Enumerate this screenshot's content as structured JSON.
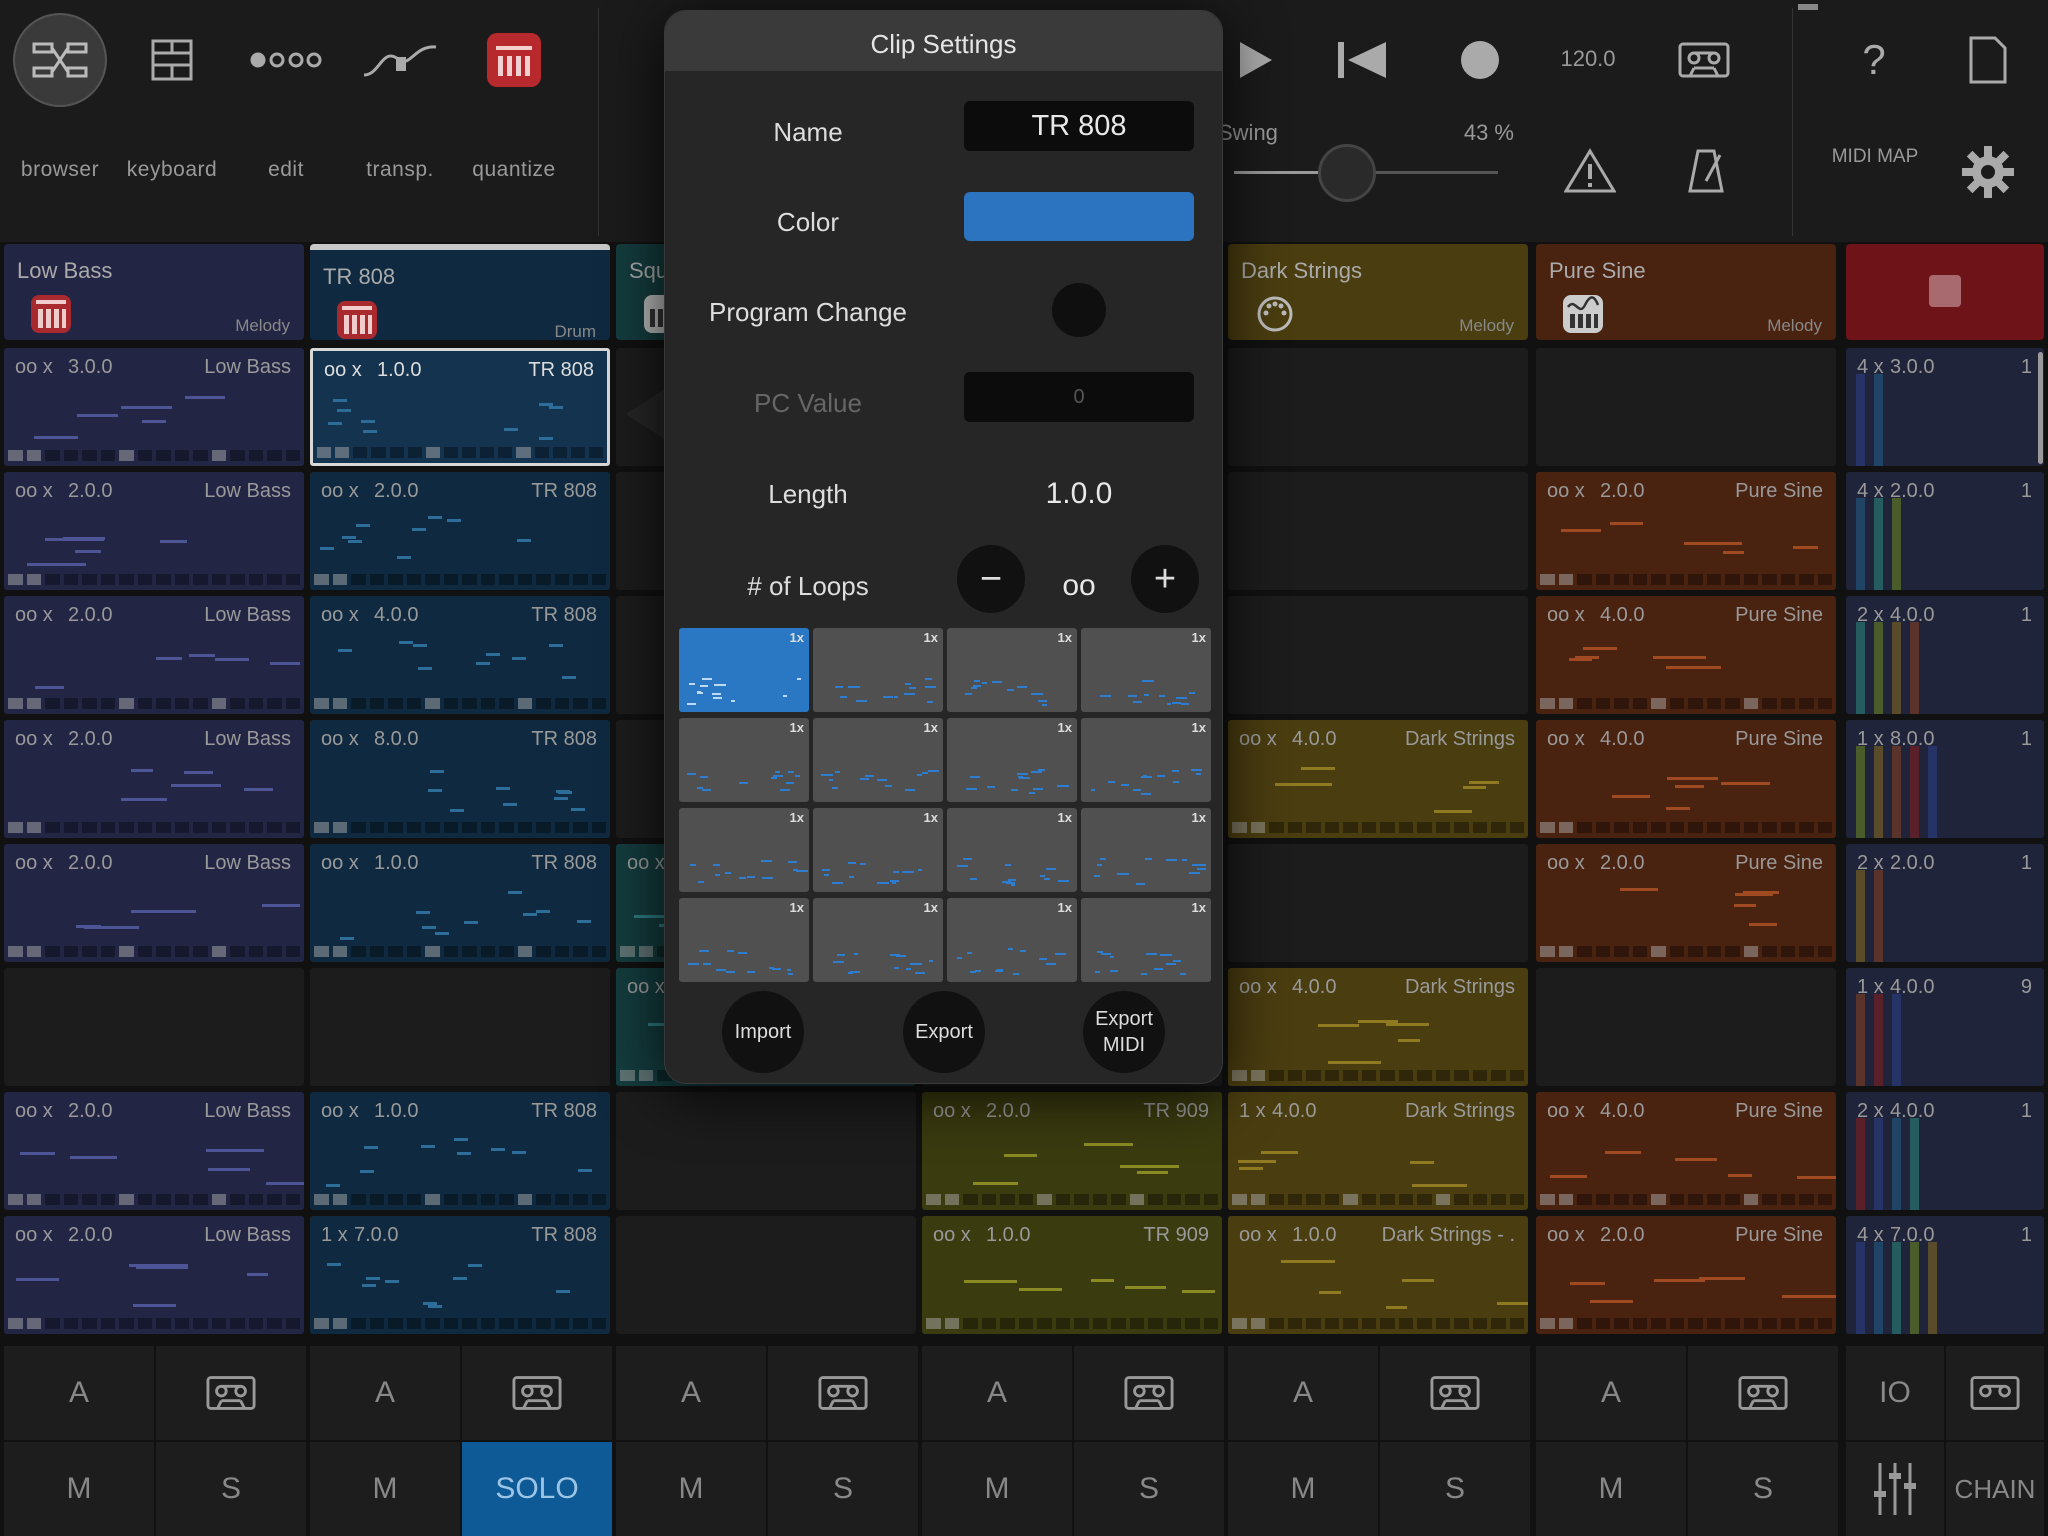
{
  "toolbar": {
    "buttons": [
      {
        "label": "browser",
        "icon": "browser-icon"
      },
      {
        "label": "keyboard",
        "icon": "keyboard-icon"
      },
      {
        "label": "edit",
        "icon": "edit-dots-icon"
      },
      {
        "label": "transp.",
        "icon": "transpose-icon"
      },
      {
        "label": "quantize",
        "icon": "quantize-icon"
      }
    ],
    "tempo": "120.0",
    "swing_label": "Swing",
    "swing_value": "43 %",
    "swing_fraction": 0.43,
    "help": "?",
    "midi_map": "MIDI MAP"
  },
  "tracks": [
    {
      "name": "Low Bass",
      "type": "Melody",
      "color": "#232545"
    },
    {
      "name": "TR 808",
      "type": "Drum",
      "color": "#0f2a40"
    },
    {
      "name": "Squ",
      "type": "",
      "color": "#143c3e"
    },
    {
      "name": "",
      "type": "",
      "color": "#3b3b10"
    },
    {
      "name": "Dark Strings",
      "type": "Melody",
      "color": "#4a3d10"
    },
    {
      "name": "Pure Sine",
      "type": "Melody",
      "color": "#4a2210"
    }
  ],
  "clips": {
    "c0": [
      {
        "loops": "oo x",
        "len": "3.0.0",
        "name": "Low Bass"
      },
      {
        "loops": "oo x",
        "len": "2.0.0",
        "name": "Low Bass"
      },
      {
        "loops": "oo x",
        "len": "2.0.0",
        "name": "Low Bass"
      },
      {
        "loops": "oo x",
        "len": "2.0.0",
        "name": "Low Bass"
      },
      {
        "loops": "oo x",
        "len": "2.0.0",
        "name": "Low Bass"
      },
      null,
      {
        "loops": "oo x",
        "len": "2.0.0",
        "name": "Low Bass"
      },
      {
        "loops": "oo x",
        "len": "2.0.0",
        "name": "Low Bass"
      }
    ],
    "c1": [
      {
        "loops": "oo x",
        "len": "1.0.0",
        "name": "TR 808",
        "sel": true
      },
      {
        "loops": "oo x",
        "len": "2.0.0",
        "name": "TR 808"
      },
      {
        "loops": "oo x",
        "len": "4.0.0",
        "name": "TR 808"
      },
      {
        "loops": "oo x",
        "len": "8.0.0",
        "name": "TR 808"
      },
      {
        "loops": "oo x",
        "len": "1.0.0",
        "name": "TR 808"
      },
      null,
      {
        "loops": "oo x",
        "len": "1.0.0",
        "name": "TR 808"
      },
      {
        "loops": "1 x",
        "len": "7.0.0",
        "name": "TR 808"
      }
    ],
    "c2": [
      null,
      null,
      null,
      null,
      {
        "loops": "oo x",
        "len": "",
        "name": ""
      },
      {
        "loops": "oo x",
        "len": "",
        "name": ""
      },
      null,
      null
    ],
    "c3": [
      null,
      null,
      null,
      null,
      null,
      null,
      {
        "loops": "oo x",
        "len": "2.0.0",
        "name": "TR 909"
      },
      {
        "loops": "oo x",
        "len": "1.0.0",
        "name": "TR 909"
      }
    ],
    "c4": [
      null,
      null,
      null,
      {
        "loops": "oo x",
        "len": "4.0.0",
        "name": "Dark Strings"
      },
      null,
      {
        "loops": "oo x",
        "len": "4.0.0",
        "name": "Dark Strings"
      },
      {
        "loops": "1 x",
        "len": "4.0.0",
        "name": "Dark Strings"
      },
      {
        "loops": "oo x",
        "len": "1.0.0",
        "name": "Dark Strings - ."
      }
    ],
    "c5": [
      null,
      {
        "loops": "oo x",
        "len": "2.0.0",
        "name": "Pure Sine"
      },
      {
        "loops": "oo x",
        "len": "4.0.0",
        "name": "Pure Sine"
      },
      {
        "loops": "oo x",
        "len": "4.0.0",
        "name": "Pure Sine"
      },
      {
        "loops": "oo x",
        "len": "2.0.0",
        "name": "Pure Sine"
      },
      null,
      {
        "loops": "oo x",
        "len": "4.0.0",
        "name": "Pure Sine"
      },
      {
        "loops": "oo x",
        "len": "2.0.0",
        "name": "Pure Sine"
      }
    ]
  },
  "scenes": [
    {
      "loops": "4 x",
      "len": "3.0.0",
      "count": "1"
    },
    {
      "loops": "4 x",
      "len": "2.0.0",
      "count": "1"
    },
    {
      "loops": "2 x",
      "len": "4.0.0",
      "count": "1"
    },
    {
      "loops": "1 x",
      "len": "8.0.0",
      "count": "1"
    },
    {
      "loops": "2 x",
      "len": "2.0.0",
      "count": "1"
    },
    {
      "loops": "1 x",
      "len": "4.0.0",
      "count": "9"
    },
    {
      "loops": "2 x",
      "len": "4.0.0",
      "count": "1"
    },
    {
      "loops": "4 x",
      "len": "7.0.0",
      "count": "1"
    }
  ],
  "bottom": {
    "a": "A",
    "m": "M",
    "s": "S",
    "solo": "SOLO",
    "io": "IO",
    "chain": "CHAIN"
  },
  "popup": {
    "title": "Clip Settings",
    "name_label": "Name",
    "name_value": "TR 808",
    "color_label": "Color",
    "color_value": "#2c74bf",
    "pc_label": "Program Change",
    "pcv_label": "PC Value",
    "pcv_value": "0",
    "length_label": "Length",
    "length_value": "1.0.0",
    "loops_label": "# of Loops",
    "loops_value": "oo",
    "minus": "−",
    "plus": "+",
    "pattern_badge": "1x",
    "import": "Import",
    "export": "Export",
    "export_midi": "Export MIDI"
  }
}
